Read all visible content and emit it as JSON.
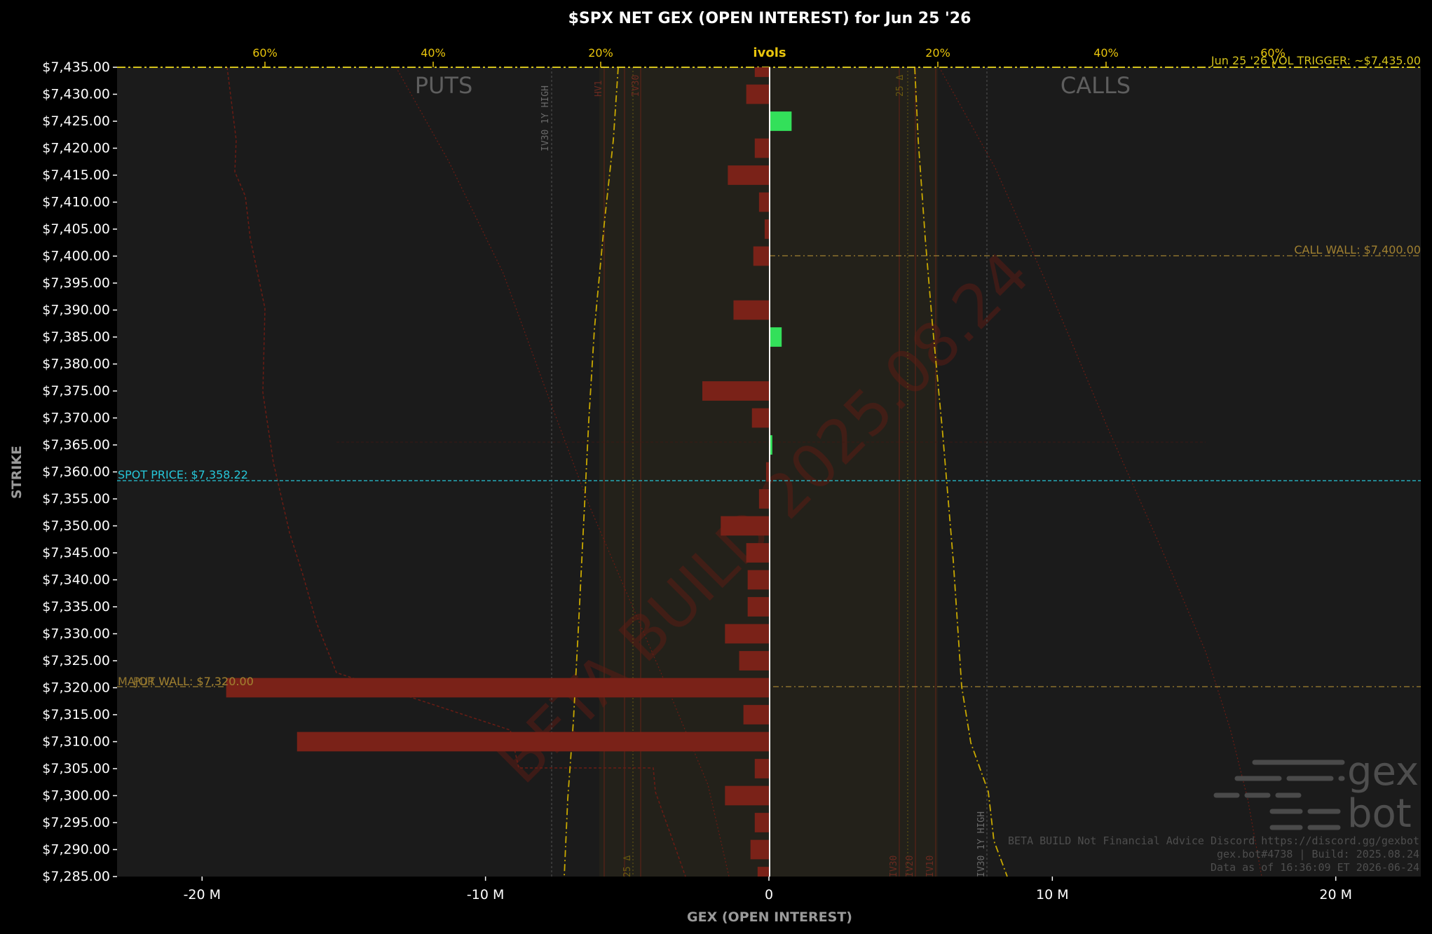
{
  "title": "$SPX NET GEX (OPEN INTEREST) for Jun 25 '26",
  "colors": {
    "background": "#000000",
    "plot_bg": "#1b1b1b",
    "negative_bar": "#7a2218",
    "positive_bar": "#33e05a",
    "spot": "#26c6d8",
    "wall": "#a08030",
    "trigger": "#d4c21c",
    "ivol": "#c8a800",
    "text": "#ffffff",
    "axis_label": "#9a9a9a"
  },
  "labels": {
    "puts": "PUTS",
    "calls": "CALLS",
    "ivols": "ivols",
    "spot": "SPOT PRICE: $7,358.22",
    "call_wall": "CALL WALL: $7,400.00",
    "put_wall": "PUT WALL: $7,320.00",
    "major_wall": "MAJOR WALL: $7,320.00",
    "vol_trigger": "Jun 25 '26 VOL TRIGGER: ~$7,435.00",
    "iv30_1y_high_left": "IV30 1Y HIGH",
    "iv30_1y_high_right": "IV30 1Y HIGH",
    "hv1": "HV1",
    "iv30": "IV30",
    "delta25_top": "25 Δ",
    "delta25_bottom": "25 Δ",
    "iv30_bottom": "IV30",
    "iv20": "IV20",
    "iv10": "IV10",
    "watermark": "BETA BUILD 2025.08.24",
    "logo_top": "gex",
    "logo_bottom": "bot",
    "footer_1": "BETA BUILD Not Financial Advice Discord https://discord.gg/gexbot",
    "footer_2": "gex.bot#4738 | Build: 2025.08.24",
    "footer_3": "Data as of 16:36:09 ET 2026-06-24"
  },
  "chart_data": {
    "type": "bar",
    "orientation": "horizontal",
    "title": "$SPX NET GEX (OPEN INTEREST) for Jun 25 '26",
    "xlabel": "GEX (OPEN INTEREST)",
    "ylabel": "STRIKE",
    "xlim": [
      -23,
      23
    ],
    "ylim": [
      7285,
      7435
    ],
    "x_ticks": [
      -20,
      -10,
      0,
      10,
      20
    ],
    "x_tick_labels": [
      "-20 M",
      "-10 M",
      "0",
      "10 M",
      "20 M"
    ],
    "y_ticks": [
      7435,
      7430,
      7425,
      7420,
      7415,
      7410,
      7405,
      7400,
      7395,
      7390,
      7385,
      7380,
      7375,
      7370,
      7365,
      7360,
      7355,
      7350,
      7345,
      7340,
      7335,
      7330,
      7325,
      7320,
      7315,
      7310,
      7305,
      7300,
      7295,
      7290,
      7285
    ],
    "y_tick_labels": [
      "$7,435.00",
      "$7,430.00",
      "$7,425.00",
      "$7,420.00",
      "$7,415.00",
      "$7,410.00",
      "$7,405.00",
      "$7,400.00",
      "$7,395.00",
      "$7,390.00",
      "$7,385.00",
      "$7,380.00",
      "$7,375.00",
      "$7,370.00",
      "$7,365.00",
      "$7,360.00",
      "$7,355.00",
      "$7,350.00",
      "$7,345.00",
      "$7,340.00",
      "$7,335.00",
      "$7,330.00",
      "$7,325.00",
      "$7,320.00",
      "$7,315.00",
      "$7,310.00",
      "$7,305.00",
      "$7,300.00",
      "$7,295.00",
      "$7,290.00",
      "$7,285.00"
    ],
    "top_axis_labels": [
      "60%",
      "40%",
      "20%",
      "ivols",
      "20%",
      "40%",
      "60%"
    ],
    "bars": [
      {
        "strike": 7435,
        "value": -0.5
      },
      {
        "strike": 7430,
        "value": -0.8
      },
      {
        "strike": 7425,
        "value": 0.8
      },
      {
        "strike": 7420,
        "value": -0.5
      },
      {
        "strike": 7415,
        "value": -1.45
      },
      {
        "strike": 7410,
        "value": -0.35
      },
      {
        "strike": 7405,
        "value": -0.15
      },
      {
        "strike": 7400,
        "value": -0.55
      },
      {
        "strike": 7390,
        "value": -1.25
      },
      {
        "strike": 7385,
        "value": 0.45
      },
      {
        "strike": 7375,
        "value": -2.35
      },
      {
        "strike": 7370,
        "value": -0.6
      },
      {
        "strike": 7365,
        "value": 0.12
      },
      {
        "strike": 7360,
        "value": -0.1
      },
      {
        "strike": 7355,
        "value": -0.35
      },
      {
        "strike": 7350,
        "value": -1.7
      },
      {
        "strike": 7345,
        "value": -0.8
      },
      {
        "strike": 7340,
        "value": -0.75
      },
      {
        "strike": 7335,
        "value": -0.75
      },
      {
        "strike": 7330,
        "value": -1.55
      },
      {
        "strike": 7325,
        "value": -1.05
      },
      {
        "strike": 7320,
        "value": -19.15
      },
      {
        "strike": 7315,
        "value": -0.9
      },
      {
        "strike": 7310,
        "value": -16.65
      },
      {
        "strike": 7305,
        "value": -0.5
      },
      {
        "strike": 7300,
        "value": -1.55
      },
      {
        "strike": 7295,
        "value": -0.5
      },
      {
        "strike": 7290,
        "value": -0.65
      },
      {
        "strike": 7285,
        "value": -0.4
      }
    ],
    "spot_price": 7358.22,
    "call_wall": 7400,
    "put_wall": 7320,
    "vol_trigger": 7435,
    "grid": false
  }
}
